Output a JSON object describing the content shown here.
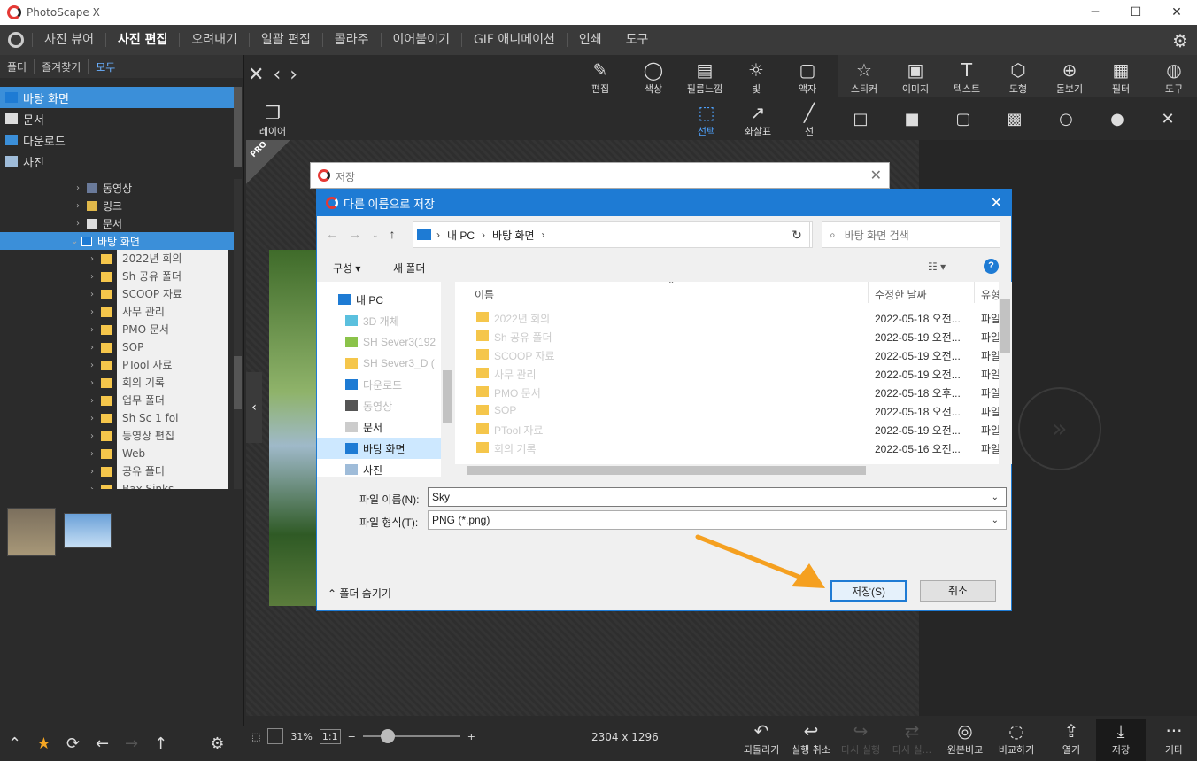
{
  "app": {
    "title": "PhotoScape X"
  },
  "window_buttons": {
    "minimize": "─",
    "maximize": "☐",
    "close": "✕"
  },
  "menu": [
    "사진 뷰어",
    "사진 편집",
    "오려내기",
    "일괄 편집",
    "콜라주",
    "이어붙이기",
    "GIF 애니메이션",
    "인쇄",
    "도구"
  ],
  "left_tabs": [
    "폴더",
    "즐겨찾기",
    "모두"
  ],
  "quick_access": [
    "바탕 화면",
    "문서",
    "다운로드",
    "사진"
  ],
  "tree": {
    "items": [
      "동영상",
      "링크",
      "문서",
      "바탕 화면"
    ],
    "subfolders": [
      "2022년 회의",
      "Sh 공유 폴더",
      "SCOOP 자료",
      "사무 관리",
      "PMO 문서",
      "SOP",
      "PTool 자료",
      "회의 기록",
      "업무 폴더",
      "Sh Sc 1 fol",
      "동영상 편집",
      "Web",
      "공유 폴더",
      "Bax Sinks"
    ]
  },
  "left_bottom": {
    "up": "⌃",
    "star": "★",
    "refresh": "⟳",
    "back": "←",
    "forward": "→",
    "upload": "↑",
    "settings": "⚙"
  },
  "nav": {
    "close": "✕",
    "prev": "‹",
    "next": "›"
  },
  "tools_top": [
    {
      "label": "편집",
      "icon": "✎"
    },
    {
      "label": "색상",
      "icon": "◯"
    },
    {
      "label": "필름느낌",
      "icon": "▤"
    },
    {
      "label": "빛",
      "icon": "☼"
    },
    {
      "label": "액자",
      "icon": "▢"
    },
    {
      "label": "스티커",
      "icon": "☆"
    },
    {
      "label": "이미지",
      "icon": "▣"
    },
    {
      "label": "텍스트",
      "icon": "T"
    },
    {
      "label": "도형",
      "icon": "⬡"
    },
    {
      "label": "돋보기",
      "icon": "⊕"
    },
    {
      "label": "필터",
      "icon": "▦"
    },
    {
      "label": "도구",
      "icon": "◍"
    }
  ],
  "tools_second": [
    {
      "label": "레이어",
      "icon": "❐"
    },
    {
      "label": "선택",
      "icon": "⬚"
    },
    {
      "label": "화살표",
      "icon": "↗"
    },
    {
      "label": "선",
      "icon": "╱"
    }
  ],
  "shapes": [
    "□",
    "■",
    "▢",
    "▩",
    "○",
    "●",
    "✕"
  ],
  "pro_badge": "PRO",
  "collapse_icon": "‹",
  "expand_icon": "»",
  "statusbar": {
    "zoom": "31%",
    "ratio": "1:1",
    "minus": "−",
    "plus": "+",
    "dimensions": "2304 x 1296",
    "actions": [
      {
        "label": "되돌리기",
        "icon": "↶"
      },
      {
        "label": "실행 취소",
        "icon": "↩"
      },
      {
        "label": "다시 실행",
        "icon": "↪"
      },
      {
        "label": "다시 실...",
        "icon": "⇄"
      },
      {
        "label": "원본비교",
        "icon": "◎"
      },
      {
        "label": "비교하기",
        "icon": "◌"
      },
      {
        "label": "열기",
        "icon": "⇪"
      },
      {
        "label": "저장",
        "icon": "⤓"
      },
      {
        "label": "기타",
        "icon": "···"
      }
    ]
  },
  "outer_dialog": {
    "title": "저장",
    "close": "✕"
  },
  "dialog": {
    "title": "다른 이름으로 저장",
    "close": "✕",
    "breadcrumb": [
      "내 PC",
      "바탕 화면"
    ],
    "search_placeholder": "바탕 화면 검색",
    "organize": "구성 ▾",
    "new_folder": "새 폴더",
    "view_icon": "☷ ▾",
    "help": "?",
    "nav_items": [
      "내 PC",
      "3D 개체",
      "SH Sever3(192",
      "SH Sever3_D (",
      "다운로드",
      "동영상",
      "문서",
      "바탕 화면",
      "사진"
    ],
    "columns": {
      "name": "이름",
      "date": "수정한 날짜",
      "type": "유형"
    },
    "files": [
      {
        "name": "2022년 회의",
        "date": "2022-05-18 오전...",
        "type": "파일"
      },
      {
        "name": "Sh 공유 폴더",
        "date": "2022-05-19 오전...",
        "type": "파일"
      },
      {
        "name": "SCOOP 자료",
        "date": "2022-05-19 오전...",
        "type": "파일"
      },
      {
        "name": "사무 관리",
        "date": "2022-05-19 오전...",
        "type": "파일"
      },
      {
        "name": "PMO 문서",
        "date": "2022-05-18 오후...",
        "type": "파일"
      },
      {
        "name": "SOP",
        "date": "2022-05-18 오전...",
        "type": "파일"
      },
      {
        "name": "PTool 자료",
        "date": "2022-05-19 오전...",
        "type": "파일"
      },
      {
        "name": "회의 기록",
        "date": "2022-05-16 오전...",
        "type": "파일"
      }
    ],
    "filename_label": "파일 이름(N):",
    "filename_value": "Sky",
    "filetype_label": "파일 형식(T):",
    "filetype_value": "PNG (*.png)",
    "hide_folders": "폴더 숨기기",
    "save_button": "저장(S)",
    "cancel_button": "취소"
  },
  "colors": {
    "accent": "#1e7bd4",
    "selection": "#3b8fd9",
    "arrow": "#f5a020"
  }
}
